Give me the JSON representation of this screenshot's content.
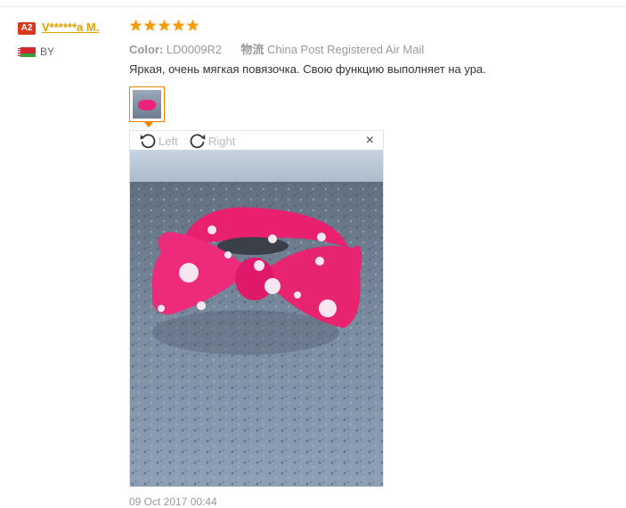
{
  "reviewer": {
    "level_badge": "A2",
    "name": "V******a M.",
    "country": "BY"
  },
  "review": {
    "rating": 5,
    "color_label": "Color:",
    "color_value": "LD0009R2",
    "shipping_label": "物流",
    "shipping_value": "China Post Registered Air Mail",
    "text": "Яркая, очень мягкая повязочка. Свою функцию выполняет на ура.",
    "date": "09 Oct 2017 00:44"
  },
  "viewer": {
    "rotate_left_label": "Left",
    "rotate_right_label": "Right",
    "close_label": "×"
  },
  "colors": {
    "star": "#f5a000",
    "username": "#e0a000",
    "badge": "#d9381e",
    "thumb_border": "#f08200",
    "headband_pink": "#ee2a7b"
  },
  "icons": [
    "star-icon",
    "rotate-left-icon",
    "rotate-right-icon",
    "close-icon",
    "belarus-flag-icon"
  ]
}
